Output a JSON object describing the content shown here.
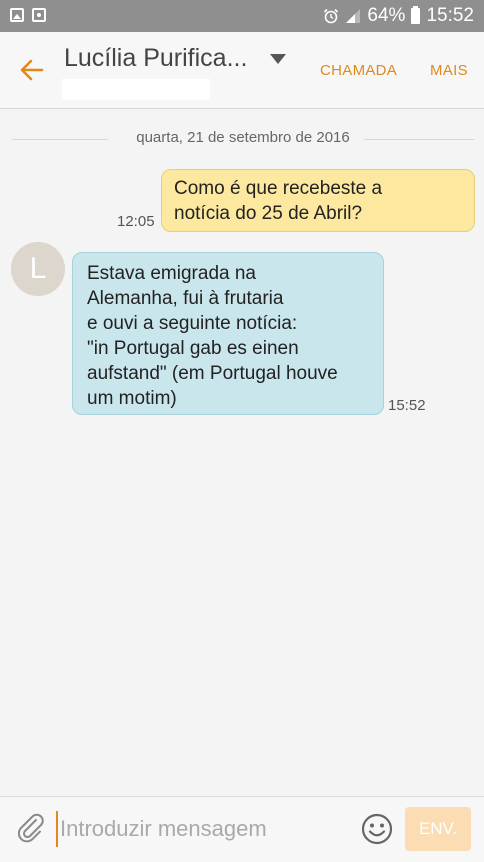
{
  "status_bar": {
    "battery": "64%",
    "time": "15:52",
    "icons": [
      "image-icon",
      "save-icon",
      "alarm-icon",
      "signal-icon",
      "battery-icon"
    ]
  },
  "header": {
    "contact_name": "Lucília Purifica...",
    "call_label": "CHAMADA",
    "more_label": "MAIS",
    "accent_color": "#e08a1e"
  },
  "conversation": {
    "date": "quarta, 21 de setembro de 2016",
    "messages": [
      {
        "direction": "sent",
        "lines": [
          "Como é que recebeste a",
          "notícia do 25 de Abril?"
        ],
        "time": "12:05",
        "color": "#fce99f"
      },
      {
        "direction": "received",
        "avatar_letter": "L",
        "lines": [
          "Estava emigrada na",
          "Alemanha, fui à frutaria",
          "e ouvi a seguinte notícia:",
          "\"in Portugal gab es einen",
          "aufstand\" (em Portugal houve",
          "um motim)"
        ],
        "time": "15:52",
        "color": "#c9e6ed"
      }
    ]
  },
  "composer": {
    "placeholder": "Introduzir mensagem",
    "value": "",
    "send_label": "ENV."
  }
}
